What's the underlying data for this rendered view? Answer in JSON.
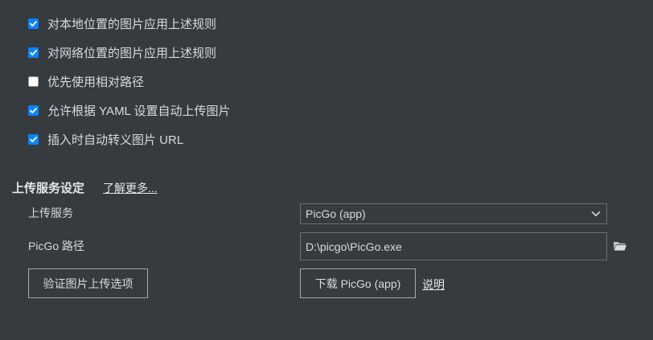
{
  "image_settings": {
    "options": [
      {
        "label": "对本地位置的图片应用上述规则",
        "checked": true
      },
      {
        "label": "对网络位置的图片应用上述规则",
        "checked": true
      },
      {
        "label": "优先使用相对路径",
        "checked": false
      },
      {
        "label": "允许根据 YAML 设置自动上传图片",
        "checked": true
      },
      {
        "label": "插入时自动转义图片 URL",
        "checked": true
      }
    ]
  },
  "upload_section": {
    "title": "上传服务设定",
    "learn_more": "了解更多...",
    "service_label": "上传服务",
    "service_value": "PicGo (app)",
    "path_label": "PicGo 路径",
    "path_value": "D:\\picgo\\PicGo.exe",
    "verify_button": "验证图片上传选项",
    "download_button": "下载 PicGo (app)",
    "explain_link": "说明"
  },
  "colors": {
    "background": "#363b40",
    "checkbox_accent": "#0a84ff"
  },
  "icons": {
    "select_arrow": "chevron-down-icon",
    "browse": "folder-icon"
  }
}
